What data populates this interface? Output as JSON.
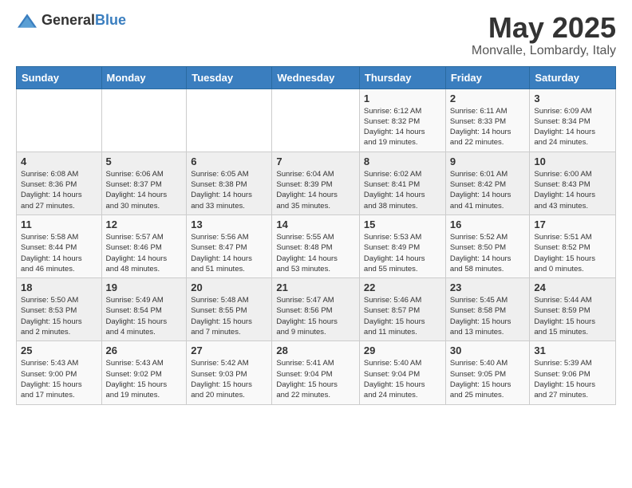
{
  "logo": {
    "text_general": "General",
    "text_blue": "Blue"
  },
  "header": {
    "month_title": "May 2025",
    "location": "Monvalle, Lombardy, Italy"
  },
  "weekdays": [
    "Sunday",
    "Monday",
    "Tuesday",
    "Wednesday",
    "Thursday",
    "Friday",
    "Saturday"
  ],
  "weeks": [
    [
      {
        "day": "",
        "info": ""
      },
      {
        "day": "",
        "info": ""
      },
      {
        "day": "",
        "info": ""
      },
      {
        "day": "",
        "info": ""
      },
      {
        "day": "1",
        "info": "Sunrise: 6:12 AM\nSunset: 8:32 PM\nDaylight: 14 hours and 19 minutes."
      },
      {
        "day": "2",
        "info": "Sunrise: 6:11 AM\nSunset: 8:33 PM\nDaylight: 14 hours and 22 minutes."
      },
      {
        "day": "3",
        "info": "Sunrise: 6:09 AM\nSunset: 8:34 PM\nDaylight: 14 hours and 24 minutes."
      }
    ],
    [
      {
        "day": "4",
        "info": "Sunrise: 6:08 AM\nSunset: 8:36 PM\nDaylight: 14 hours and 27 minutes."
      },
      {
        "day": "5",
        "info": "Sunrise: 6:06 AM\nSunset: 8:37 PM\nDaylight: 14 hours and 30 minutes."
      },
      {
        "day": "6",
        "info": "Sunrise: 6:05 AM\nSunset: 8:38 PM\nDaylight: 14 hours and 33 minutes."
      },
      {
        "day": "7",
        "info": "Sunrise: 6:04 AM\nSunset: 8:39 PM\nDaylight: 14 hours and 35 minutes."
      },
      {
        "day": "8",
        "info": "Sunrise: 6:02 AM\nSunset: 8:41 PM\nDaylight: 14 hours and 38 minutes."
      },
      {
        "day": "9",
        "info": "Sunrise: 6:01 AM\nSunset: 8:42 PM\nDaylight: 14 hours and 41 minutes."
      },
      {
        "day": "10",
        "info": "Sunrise: 6:00 AM\nSunset: 8:43 PM\nDaylight: 14 hours and 43 minutes."
      }
    ],
    [
      {
        "day": "11",
        "info": "Sunrise: 5:58 AM\nSunset: 8:44 PM\nDaylight: 14 hours and 46 minutes."
      },
      {
        "day": "12",
        "info": "Sunrise: 5:57 AM\nSunset: 8:46 PM\nDaylight: 14 hours and 48 minutes."
      },
      {
        "day": "13",
        "info": "Sunrise: 5:56 AM\nSunset: 8:47 PM\nDaylight: 14 hours and 51 minutes."
      },
      {
        "day": "14",
        "info": "Sunrise: 5:55 AM\nSunset: 8:48 PM\nDaylight: 14 hours and 53 minutes."
      },
      {
        "day": "15",
        "info": "Sunrise: 5:53 AM\nSunset: 8:49 PM\nDaylight: 14 hours and 55 minutes."
      },
      {
        "day": "16",
        "info": "Sunrise: 5:52 AM\nSunset: 8:50 PM\nDaylight: 14 hours and 58 minutes."
      },
      {
        "day": "17",
        "info": "Sunrise: 5:51 AM\nSunset: 8:52 PM\nDaylight: 15 hours and 0 minutes."
      }
    ],
    [
      {
        "day": "18",
        "info": "Sunrise: 5:50 AM\nSunset: 8:53 PM\nDaylight: 15 hours and 2 minutes."
      },
      {
        "day": "19",
        "info": "Sunrise: 5:49 AM\nSunset: 8:54 PM\nDaylight: 15 hours and 4 minutes."
      },
      {
        "day": "20",
        "info": "Sunrise: 5:48 AM\nSunset: 8:55 PM\nDaylight: 15 hours and 7 minutes."
      },
      {
        "day": "21",
        "info": "Sunrise: 5:47 AM\nSunset: 8:56 PM\nDaylight: 15 hours and 9 minutes."
      },
      {
        "day": "22",
        "info": "Sunrise: 5:46 AM\nSunset: 8:57 PM\nDaylight: 15 hours and 11 minutes."
      },
      {
        "day": "23",
        "info": "Sunrise: 5:45 AM\nSunset: 8:58 PM\nDaylight: 15 hours and 13 minutes."
      },
      {
        "day": "24",
        "info": "Sunrise: 5:44 AM\nSunset: 8:59 PM\nDaylight: 15 hours and 15 minutes."
      }
    ],
    [
      {
        "day": "25",
        "info": "Sunrise: 5:43 AM\nSunset: 9:00 PM\nDaylight: 15 hours and 17 minutes."
      },
      {
        "day": "26",
        "info": "Sunrise: 5:43 AM\nSunset: 9:02 PM\nDaylight: 15 hours and 19 minutes."
      },
      {
        "day": "27",
        "info": "Sunrise: 5:42 AM\nSunset: 9:03 PM\nDaylight: 15 hours and 20 minutes."
      },
      {
        "day": "28",
        "info": "Sunrise: 5:41 AM\nSunset: 9:04 PM\nDaylight: 15 hours and 22 minutes."
      },
      {
        "day": "29",
        "info": "Sunrise: 5:40 AM\nSunset: 9:04 PM\nDaylight: 15 hours and 24 minutes."
      },
      {
        "day": "30",
        "info": "Sunrise: 5:40 AM\nSunset: 9:05 PM\nDaylight: 15 hours and 25 minutes."
      },
      {
        "day": "31",
        "info": "Sunrise: 5:39 AM\nSunset: 9:06 PM\nDaylight: 15 hours and 27 minutes."
      }
    ]
  ]
}
